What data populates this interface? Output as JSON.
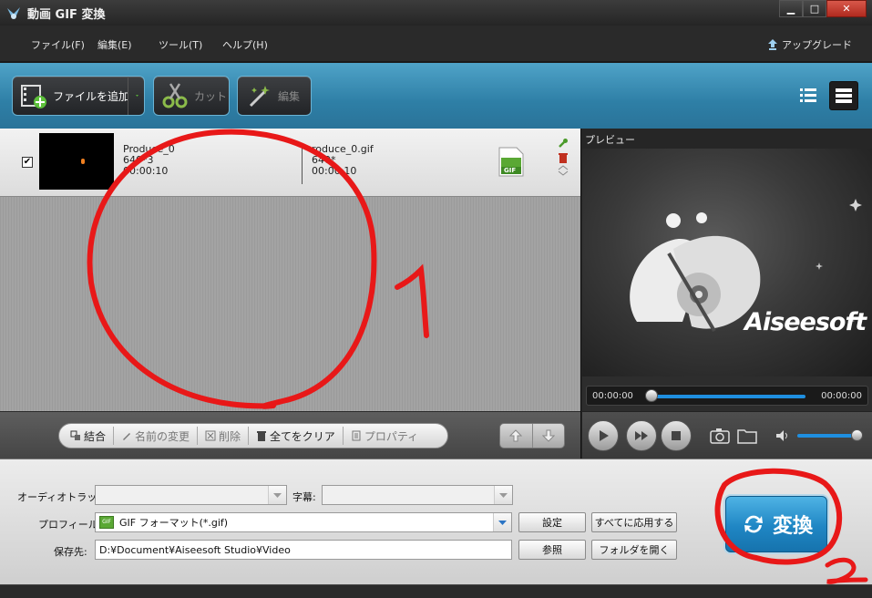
{
  "window": {
    "title": "動画 GIF 変換",
    "min_glyph": "▁",
    "max_glyph": "□",
    "close_glyph": "✕"
  },
  "menu": {
    "items": [
      "ファイル(F)",
      "編集(E)",
      "ツール(T)",
      "ヘルプ(H)"
    ],
    "upgrade": "アップグレード"
  },
  "toolbar": {
    "add_file": "ファイルを追加",
    "cut": "カット",
    "edit": "編集"
  },
  "file": {
    "checked": "✔",
    "source_name": "Produce_0",
    "source_resolution": "640*3",
    "source_duration": "00:00:10",
    "output_name": "roduce_0.gif",
    "output_resolution": "640*",
    "output_duration": "00:00:10",
    "output_badge": "GIF"
  },
  "listbar": {
    "merge": "結合",
    "rename": "名前の変更",
    "delete": "削除",
    "clear_all": "全てをクリア",
    "properties": "プロパティ"
  },
  "preview": {
    "label": "プレビュー",
    "brand": "Aiseesoft",
    "time_start": "00:00:00",
    "time_end": "00:00:00"
  },
  "settings": {
    "audio_track_label": "オーディオトラック:",
    "audio_track_value": "",
    "subtitle_label": "字幕:",
    "subtitle_value": "",
    "profile_label": "プロフィール:",
    "profile_value": "GIF フォーマット(*.gif)",
    "profile_icon_text": "GIF",
    "settings_button": "設定",
    "apply_all_button": "すべてに応用する",
    "save_label": "保存先:",
    "save_path": "D:¥Document¥Aiseesoft Studio¥Video",
    "browse_button": "参照",
    "open_folder_button": "フォルダを開く",
    "convert_button": "変換"
  },
  "annotations": {
    "mark_1": "1",
    "mark_2": "2",
    "color": "#e81818"
  }
}
